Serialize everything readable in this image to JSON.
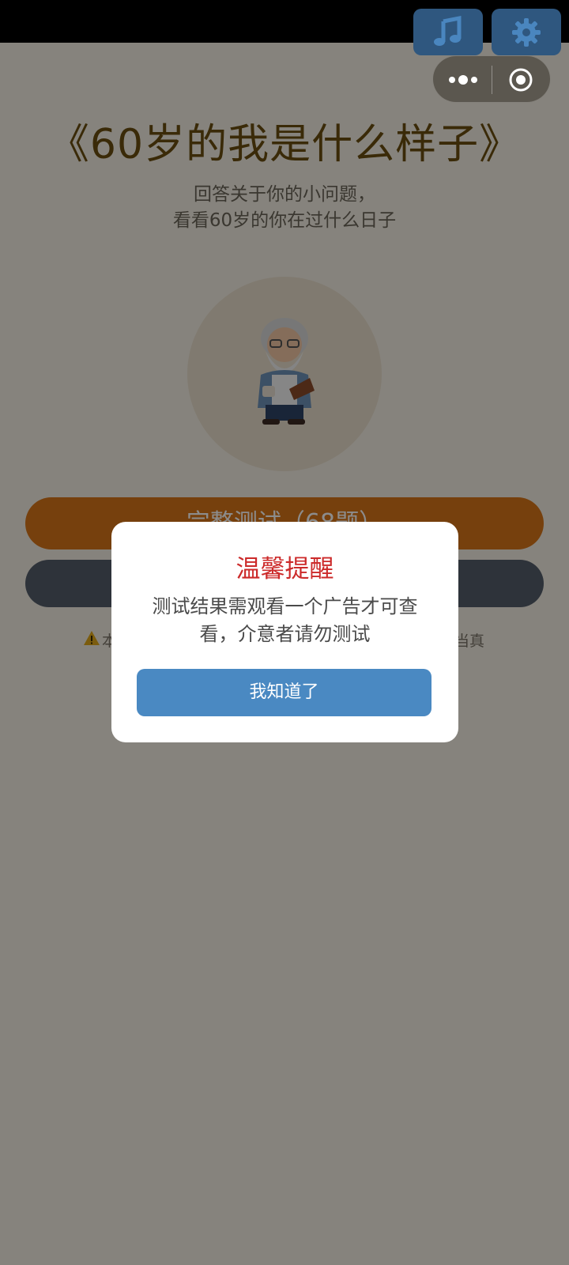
{
  "title": "《60岁的我是什么样子》",
  "subtitle_line1": "回答关于你的小问题，",
  "subtitle_line2": "看看60岁的你在过什么日子",
  "primary_button": "完整测试（68题）",
  "disclaimer": {
    "start": "本",
    "end": "当真"
  },
  "capsule": {
    "more_icon": "more-dots-icon",
    "close_icon": "target-icon"
  },
  "top_controls": {
    "music_icon": "music-note-icon",
    "settings_icon": "gear-icon"
  },
  "dialog": {
    "title": "温馨提醒",
    "message": "测试结果需观看一个广告才可查看，介意者请勿测试",
    "confirm": "我知道了"
  },
  "colors": {
    "title": "#6a4e10",
    "primary_button": "#d87518",
    "secondary_button": "#545d6b",
    "dialog_title": "#cc2a2a",
    "dialog_button": "#4a89c2",
    "control_button": "#2f577f"
  }
}
